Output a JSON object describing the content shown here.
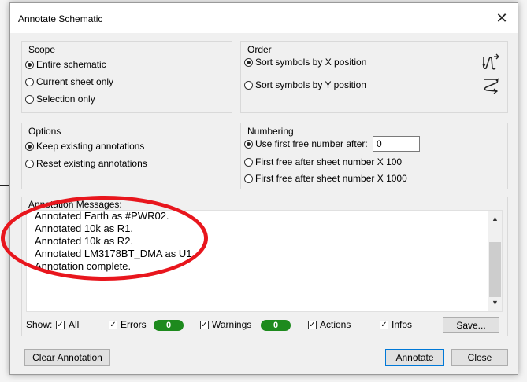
{
  "dialog": {
    "title": "Annotate Schematic"
  },
  "scope": {
    "title": "Scope",
    "options": [
      "Entire schematic",
      "Current sheet only",
      "Selection only"
    ],
    "selected": 0
  },
  "order": {
    "title": "Order",
    "options": [
      "Sort symbols by X position",
      "Sort symbols by Y position"
    ],
    "selected": 0
  },
  "options_group": {
    "title": "Options",
    "options": [
      "Keep existing annotations",
      "Reset existing annotations"
    ],
    "selected": 0
  },
  "numbering": {
    "title": "Numbering",
    "options": [
      "Use first free number after:",
      "First free after sheet number X 100",
      "First free after sheet number X 1000"
    ],
    "selected": 0,
    "start_value": "0"
  },
  "messages": {
    "title": "Annotation Messages:",
    "lines": [
      "Annotated Earth as #PWR02.",
      "Annotated 10k as R1.",
      "Annotated 10k as R2.",
      "Annotated LM3178BT_DMA as U1.",
      "Annotation complete."
    ]
  },
  "filters": {
    "show_label": "Show:",
    "all": "All",
    "errors": "Errors",
    "errors_count": "0",
    "warnings": "Warnings",
    "warnings_count": "0",
    "actions": "Actions",
    "infos": "Infos",
    "save": "Save..."
  },
  "buttons": {
    "clear": "Clear Annotation",
    "annotate": "Annotate",
    "close": "Close"
  },
  "colors": {
    "badge": "#1d8a1d",
    "highlight": "#e8161d",
    "primary_border": "#0078d7"
  }
}
